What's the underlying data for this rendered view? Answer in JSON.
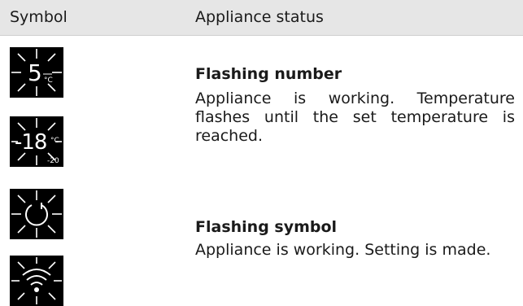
{
  "header": {
    "symbol_col": "Symbol",
    "status_col": "Appliance status"
  },
  "rows": [
    {
      "title": "Flashing number",
      "description": "Appliance is working. Temperature flashes until the set temperature is reached.",
      "symbols": [
        {
          "icon": "flashing-5-celsius-icon",
          "number": "5",
          "unit": "°C"
        },
        {
          "icon": "flashing-minus-18-celsius-icon",
          "number": "-18",
          "unit": "°C",
          "sub": "-20"
        }
      ]
    },
    {
      "title": "Flashing symbol",
      "description": "Appliance is working. Setting is made.",
      "symbols": [
        {
          "icon": "flashing-power-icon"
        },
        {
          "icon": "flashing-wifi-icon"
        }
      ]
    }
  ],
  "colors": {
    "header_bg": "#e6e6e6",
    "icon_bg": "#000000",
    "icon_fg": "#ffffff",
    "text": "#1a1a1a"
  }
}
